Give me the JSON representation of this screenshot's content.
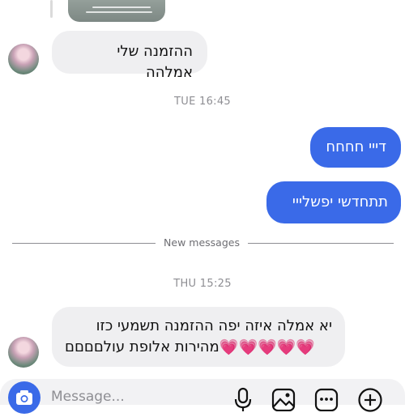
{
  "messages": {
    "received_1": "ההזמנה שלי אמלהה",
    "timestamp_1": "TUE 16:45",
    "sent_1": "דייי חחחח",
    "sent_2": "תתחדשי יפשלייי",
    "new_messages_label": "New messages",
    "timestamp_2": "THU 15:25",
    "received_2_line_1": "יא אמלה איזה יפה ההזמנה תשמעי כזו",
    "received_2_line_2": "מהירות אלופת עולםםםם",
    "received_2_hearts": "💗💗💗💗💗"
  },
  "composer": {
    "placeholder": "Message..."
  },
  "icons": {
    "camera": "camera-icon",
    "mic": "microphone-icon",
    "gallery": "gallery-icon",
    "sticker": "sticker-icon",
    "add": "plus-icon"
  },
  "colors": {
    "sent_bubble": "#3a6ae8",
    "received_bubble": "#efeff1",
    "heart": "#e0399a"
  }
}
